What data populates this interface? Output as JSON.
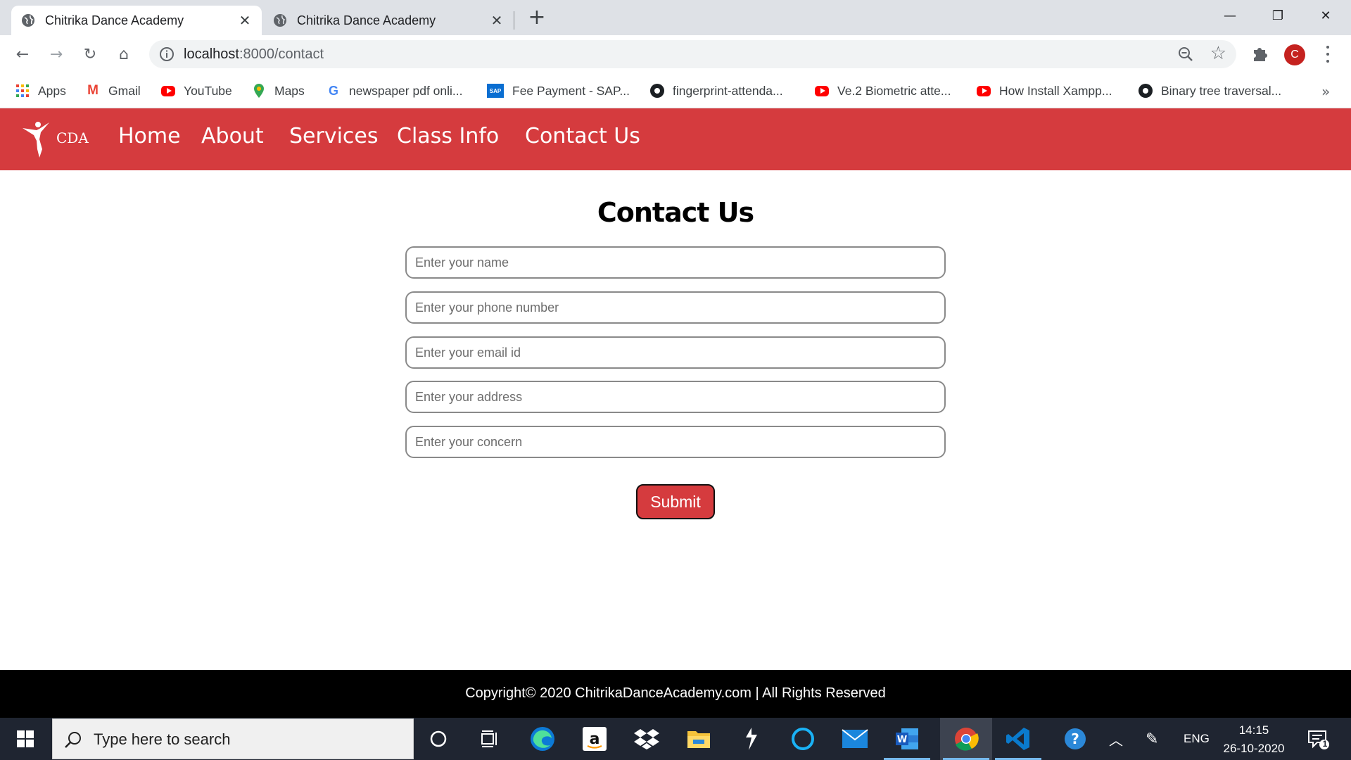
{
  "browser": {
    "tabs": [
      {
        "title": "Chitrika Dance Academy",
        "active": true
      },
      {
        "title": "Chitrika Dance Academy",
        "active": false
      }
    ],
    "url_host": "localhost",
    "url_path": ":8000/contact",
    "profile_initial": "C",
    "bookmarks": [
      {
        "label": "Apps",
        "icon": "apps-grid-icon"
      },
      {
        "label": "Gmail",
        "icon": "gmail-icon"
      },
      {
        "label": "YouTube",
        "icon": "youtube-icon"
      },
      {
        "label": "Maps",
        "icon": "maps-icon"
      },
      {
        "label": "newspaper pdf onli...",
        "icon": "google-icon"
      },
      {
        "label": "Fee Payment - SAP...",
        "icon": "sap-icon"
      },
      {
        "label": "fingerprint-attenda...",
        "icon": "github-icon"
      },
      {
        "label": "Ve.2 Biometric atte...",
        "icon": "youtube-icon"
      },
      {
        "label": "How Install Xampp...",
        "icon": "youtube-icon"
      },
      {
        "label": "Binary tree traversal...",
        "icon": "github-icon"
      }
    ]
  },
  "site": {
    "logo_text": "CDA",
    "nav": [
      "Home",
      "About",
      "Services",
      "Class Info",
      "Contact Us"
    ],
    "brand_color": "#d53b3e"
  },
  "form": {
    "title": "Contact Us",
    "fields": [
      {
        "placeholder": "Enter your name",
        "value": ""
      },
      {
        "placeholder": "Enter your phone number",
        "value": ""
      },
      {
        "placeholder": "Enter your email id",
        "value": ""
      },
      {
        "placeholder": "Enter your address",
        "value": ""
      },
      {
        "placeholder": "Enter your concern",
        "value": ""
      }
    ],
    "submit_label": "Submit"
  },
  "footer": {
    "text": "Copyright© 2020 ChitrikaDanceAcademy.com | All Rights Reserved"
  },
  "taskbar": {
    "search_placeholder": "Type here to search",
    "language": "ENG",
    "time": "14:15",
    "date": "26-10-2020",
    "notification_count": "1"
  }
}
